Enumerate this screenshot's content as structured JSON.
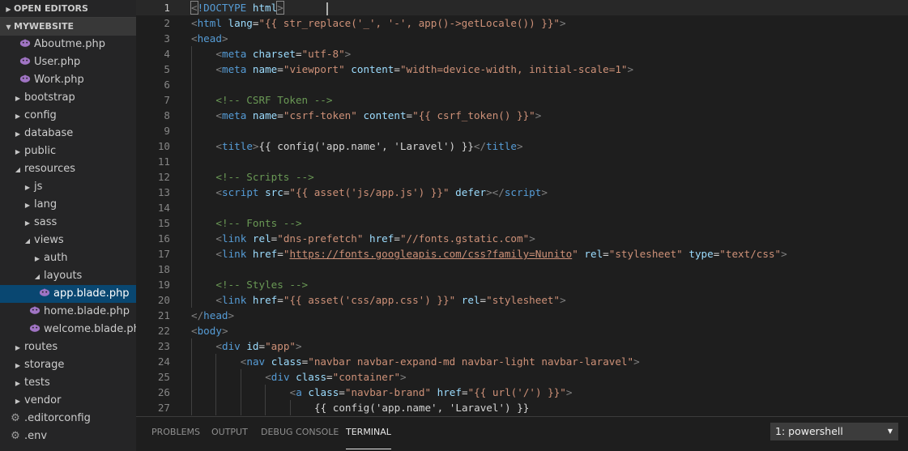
{
  "colors": {
    "sidebar_bg": "#252526",
    "editor_bg": "#1e1e1e",
    "selection": "#094771",
    "tag": "#569cd6",
    "attribute": "#9cdcfe",
    "string": "#ce9178",
    "comment": "#6a9955",
    "php_icon": "#a074c4"
  },
  "sidebar": {
    "open_editors_label": "OPEN EDITORS",
    "project_label": "MYWEBSITE",
    "items": [
      {
        "label": "Aboutme.php",
        "kind": "php",
        "depth": 1
      },
      {
        "label": "User.php",
        "kind": "php",
        "depth": 1
      },
      {
        "label": "Work.php",
        "kind": "php",
        "depth": 1
      },
      {
        "label": "bootstrap",
        "kind": "folder",
        "depth": 0,
        "expanded": false
      },
      {
        "label": "config",
        "kind": "folder",
        "depth": 0,
        "expanded": false
      },
      {
        "label": "database",
        "kind": "folder",
        "depth": 0,
        "expanded": false
      },
      {
        "label": "public",
        "kind": "folder",
        "depth": 0,
        "expanded": false
      },
      {
        "label": "resources",
        "kind": "folder",
        "depth": 0,
        "expanded": true
      },
      {
        "label": "js",
        "kind": "folder",
        "depth": 1,
        "expanded": false
      },
      {
        "label": "lang",
        "kind": "folder",
        "depth": 1,
        "expanded": false
      },
      {
        "label": "sass",
        "kind": "folder",
        "depth": 1,
        "expanded": false
      },
      {
        "label": "views",
        "kind": "folder",
        "depth": 1,
        "expanded": true
      },
      {
        "label": "auth",
        "kind": "folder",
        "depth": 2,
        "expanded": false
      },
      {
        "label": "layouts",
        "kind": "folder",
        "depth": 2,
        "expanded": true
      },
      {
        "label": "app.blade.php",
        "kind": "php",
        "depth": 3,
        "selected": true
      },
      {
        "label": "home.blade.php",
        "kind": "php",
        "depth": 2
      },
      {
        "label": "welcome.blade.php",
        "kind": "php",
        "depth": 2
      },
      {
        "label": "routes",
        "kind": "folder",
        "depth": 0,
        "expanded": false
      },
      {
        "label": "storage",
        "kind": "folder",
        "depth": 0,
        "expanded": false
      },
      {
        "label": "tests",
        "kind": "folder",
        "depth": 0,
        "expanded": false
      },
      {
        "label": "vendor",
        "kind": "folder",
        "depth": 0,
        "expanded": false
      },
      {
        "label": ".editorconfig",
        "kind": "config",
        "depth": 0
      },
      {
        "label": ".env",
        "kind": "config",
        "depth": 0
      }
    ]
  },
  "editor": {
    "lines": [
      {
        "n": "1",
        "indent": 0,
        "current": true,
        "tokens": [
          [
            "pun",
            "<"
          ],
          [
            "tag",
            "!DOCTYPE"
          ],
          [
            "txt",
            " "
          ],
          [
            "attr",
            "html"
          ],
          [
            "pun",
            ">"
          ]
        ]
      },
      {
        "n": "2",
        "indent": 0,
        "tokens": [
          [
            "pun",
            "<"
          ],
          [
            "tag",
            "html"
          ],
          [
            "txt",
            " "
          ],
          [
            "attr",
            "lang"
          ],
          [
            "txt",
            "="
          ],
          [
            "str",
            "\"{{ str_replace('_', '-', app()->getLocale()) }}\""
          ],
          [
            "pun",
            ">"
          ]
        ]
      },
      {
        "n": "3",
        "indent": 0,
        "tokens": [
          [
            "pun",
            "<"
          ],
          [
            "tag",
            "head"
          ],
          [
            "pun",
            ">"
          ]
        ]
      },
      {
        "n": "4",
        "indent": 1,
        "tokens": [
          [
            "pun",
            "<"
          ],
          [
            "tag",
            "meta"
          ],
          [
            "txt",
            " "
          ],
          [
            "attr",
            "charset"
          ],
          [
            "txt",
            "="
          ],
          [
            "str",
            "\"utf-8\""
          ],
          [
            "pun",
            ">"
          ]
        ]
      },
      {
        "n": "5",
        "indent": 1,
        "tokens": [
          [
            "pun",
            "<"
          ],
          [
            "tag",
            "meta"
          ],
          [
            "txt",
            " "
          ],
          [
            "attr",
            "name"
          ],
          [
            "txt",
            "="
          ],
          [
            "str",
            "\"viewport\""
          ],
          [
            "txt",
            " "
          ],
          [
            "attr",
            "content"
          ],
          [
            "txt",
            "="
          ],
          [
            "str",
            "\"width=device-width, initial-scale=1\""
          ],
          [
            "pun",
            ">"
          ]
        ]
      },
      {
        "n": "6",
        "indent": 1,
        "tokens": []
      },
      {
        "n": "7",
        "indent": 1,
        "tokens": [
          [
            "com",
            "<!-- CSRF Token -->"
          ]
        ]
      },
      {
        "n": "8",
        "indent": 1,
        "tokens": [
          [
            "pun",
            "<"
          ],
          [
            "tag",
            "meta"
          ],
          [
            "txt",
            " "
          ],
          [
            "attr",
            "name"
          ],
          [
            "txt",
            "="
          ],
          [
            "str",
            "\"csrf-token\""
          ],
          [
            "txt",
            " "
          ],
          [
            "attr",
            "content"
          ],
          [
            "txt",
            "="
          ],
          [
            "str",
            "\"{{ csrf_token() }}\""
          ],
          [
            "pun",
            ">"
          ]
        ]
      },
      {
        "n": "9",
        "indent": 1,
        "tokens": []
      },
      {
        "n": "10",
        "indent": 1,
        "tokens": [
          [
            "pun",
            "<"
          ],
          [
            "tag",
            "title"
          ],
          [
            "pun",
            ">"
          ],
          [
            "txt",
            "{{ config('app.name', 'Laravel') }}"
          ],
          [
            "pun",
            "</"
          ],
          [
            "tag",
            "title"
          ],
          [
            "pun",
            ">"
          ]
        ]
      },
      {
        "n": "11",
        "indent": 1,
        "tokens": []
      },
      {
        "n": "12",
        "indent": 1,
        "tokens": [
          [
            "com",
            "<!-- Scripts -->"
          ]
        ]
      },
      {
        "n": "13",
        "indent": 1,
        "tokens": [
          [
            "pun",
            "<"
          ],
          [
            "tag",
            "script"
          ],
          [
            "txt",
            " "
          ],
          [
            "attr",
            "src"
          ],
          [
            "txt",
            "="
          ],
          [
            "str",
            "\"{{ asset('js/app.js') }}\""
          ],
          [
            "txt",
            " "
          ],
          [
            "attr",
            "defer"
          ],
          [
            "pun",
            "></"
          ],
          [
            "tag",
            "script"
          ],
          [
            "pun",
            ">"
          ]
        ]
      },
      {
        "n": "14",
        "indent": 1,
        "tokens": []
      },
      {
        "n": "15",
        "indent": 1,
        "tokens": [
          [
            "com",
            "<!-- Fonts -->"
          ]
        ]
      },
      {
        "n": "16",
        "indent": 1,
        "tokens": [
          [
            "pun",
            "<"
          ],
          [
            "tag",
            "link"
          ],
          [
            "txt",
            " "
          ],
          [
            "attr",
            "rel"
          ],
          [
            "txt",
            "="
          ],
          [
            "str",
            "\"dns-prefetch\""
          ],
          [
            "txt",
            " "
          ],
          [
            "attr",
            "href"
          ],
          [
            "txt",
            "="
          ],
          [
            "str",
            "\"//fonts.gstatic.com\""
          ],
          [
            "pun",
            ">"
          ]
        ]
      },
      {
        "n": "17",
        "indent": 1,
        "tokens": [
          [
            "pun",
            "<"
          ],
          [
            "tag",
            "link"
          ],
          [
            "txt",
            " "
          ],
          [
            "attr",
            "href"
          ],
          [
            "txt",
            "="
          ],
          [
            "str",
            "\""
          ],
          [
            "url",
            "https://fonts.googleapis.com/css?family=Nunito"
          ],
          [
            "str",
            "\""
          ],
          [
            "txt",
            " "
          ],
          [
            "attr",
            "rel"
          ],
          [
            "txt",
            "="
          ],
          [
            "str",
            "\"stylesheet\""
          ],
          [
            "txt",
            " "
          ],
          [
            "attr",
            "type"
          ],
          [
            "txt",
            "="
          ],
          [
            "str",
            "\"text/css\""
          ],
          [
            "pun",
            ">"
          ]
        ]
      },
      {
        "n": "18",
        "indent": 1,
        "tokens": []
      },
      {
        "n": "19",
        "indent": 1,
        "tokens": [
          [
            "com",
            "<!-- Styles -->"
          ]
        ]
      },
      {
        "n": "20",
        "indent": 1,
        "tokens": [
          [
            "pun",
            "<"
          ],
          [
            "tag",
            "link"
          ],
          [
            "txt",
            " "
          ],
          [
            "attr",
            "href"
          ],
          [
            "txt",
            "="
          ],
          [
            "str",
            "\"{{ asset('css/app.css') }}\""
          ],
          [
            "txt",
            " "
          ],
          [
            "attr",
            "rel"
          ],
          [
            "txt",
            "="
          ],
          [
            "str",
            "\"stylesheet\""
          ],
          [
            "pun",
            ">"
          ]
        ]
      },
      {
        "n": "21",
        "indent": 0,
        "tokens": [
          [
            "pun",
            "</"
          ],
          [
            "tag",
            "head"
          ],
          [
            "pun",
            ">"
          ]
        ]
      },
      {
        "n": "22",
        "indent": 0,
        "tokens": [
          [
            "pun",
            "<"
          ],
          [
            "tag",
            "body"
          ],
          [
            "pun",
            ">"
          ]
        ]
      },
      {
        "n": "23",
        "indent": 1,
        "tokens": [
          [
            "pun",
            "<"
          ],
          [
            "tag",
            "div"
          ],
          [
            "txt",
            " "
          ],
          [
            "attr",
            "id"
          ],
          [
            "txt",
            "="
          ],
          [
            "str",
            "\"app\""
          ],
          [
            "pun",
            ">"
          ]
        ]
      },
      {
        "n": "24",
        "indent": 2,
        "tokens": [
          [
            "pun",
            "<"
          ],
          [
            "tag",
            "nav"
          ],
          [
            "txt",
            " "
          ],
          [
            "attr",
            "class"
          ],
          [
            "txt",
            "="
          ],
          [
            "str",
            "\"navbar navbar-expand-md navbar-light navbar-laravel\""
          ],
          [
            "pun",
            ">"
          ]
        ]
      },
      {
        "n": "25",
        "indent": 3,
        "tokens": [
          [
            "pun",
            "<"
          ],
          [
            "tag",
            "div"
          ],
          [
            "txt",
            " "
          ],
          [
            "attr",
            "class"
          ],
          [
            "txt",
            "="
          ],
          [
            "str",
            "\"container\""
          ],
          [
            "pun",
            ">"
          ]
        ]
      },
      {
        "n": "26",
        "indent": 4,
        "tokens": [
          [
            "pun",
            "<"
          ],
          [
            "tag",
            "a"
          ],
          [
            "txt",
            " "
          ],
          [
            "attr",
            "class"
          ],
          [
            "txt",
            "="
          ],
          [
            "str",
            "\"navbar-brand\""
          ],
          [
            "txt",
            " "
          ],
          [
            "attr",
            "href"
          ],
          [
            "txt",
            "="
          ],
          [
            "str",
            "\"{{ url('/') }}\""
          ],
          [
            "pun",
            ">"
          ]
        ]
      },
      {
        "n": "27",
        "indent": 5,
        "tokens": [
          [
            "txt",
            "{{ config('app.name', 'Laravel') }}"
          ]
        ]
      }
    ]
  },
  "panel": {
    "tabs": [
      {
        "label": "PROBLEMS",
        "active": false
      },
      {
        "label": "OUTPUT",
        "active": false
      },
      {
        "label": "DEBUG CONSOLE",
        "active": false
      },
      {
        "label": "TERMINAL",
        "active": true
      }
    ],
    "terminal_select": "1: powershell"
  }
}
